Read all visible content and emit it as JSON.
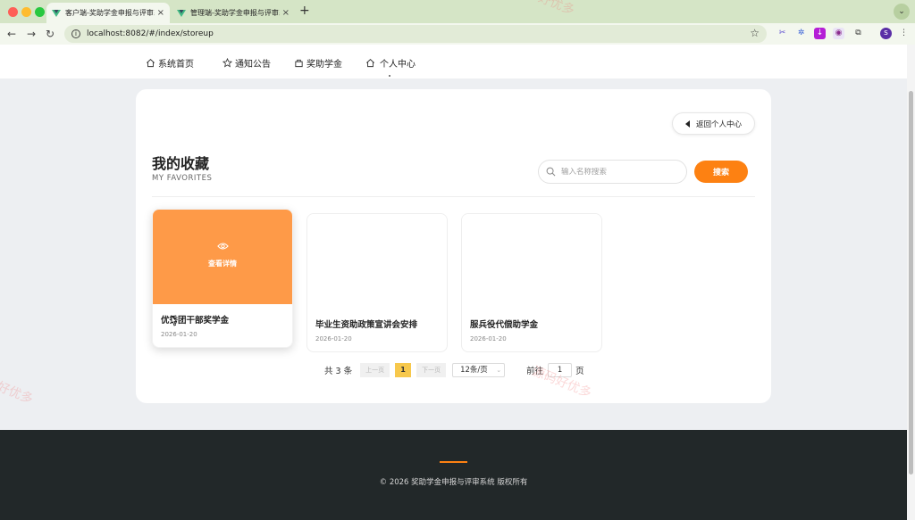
{
  "browser": {
    "tabs": [
      {
        "title": "客户端-奖助学金申报与评审系统",
        "active": true
      },
      {
        "title": "管理端-奖助学金申报与评审系统",
        "active": false
      }
    ],
    "new_tab": "+",
    "url": "localhost:8082/#/index/storeup",
    "profile_initial": "s",
    "expand_icon": "chevron-down-icon"
  },
  "nav": {
    "items": [
      {
        "label": "系统首页",
        "icon": "home-icon"
      },
      {
        "label": "通知公告",
        "icon": "star-icon"
      },
      {
        "label": "奖助学金",
        "icon": "bag-icon"
      },
      {
        "label": "个人中心",
        "icon": "home-icon"
      }
    ]
  },
  "page": {
    "back_label": "返回个人中心",
    "title": "我的收藏",
    "subtitle": "MY FAVORITES",
    "search_placeholder": "输入名称搜索",
    "search_button": "搜索",
    "view_detail": "查看详情"
  },
  "favorites": [
    {
      "name": "优秀团干部奖学金",
      "date": "2026-01-20",
      "hovered": true
    },
    {
      "name": "毕业生资助政策宣讲会安排",
      "date": "2026-01-20",
      "hovered": false
    },
    {
      "name": "服兵役代偿助学金",
      "date": "2026-01-20",
      "hovered": false
    }
  ],
  "pagination": {
    "total": "共 3 条",
    "prev": "上一页",
    "current_page": "1",
    "next": "下一页",
    "page_size": "12条/页",
    "goto_label": "前往",
    "goto_value": "1",
    "page_unit": "页"
  },
  "footer": {
    "copyright": "© 2026 奖助学金申报与评审系统 版权所有"
  },
  "watermark": [
    "源码好优多",
    "好优多"
  ],
  "colors": {
    "accent": "#fd8112",
    "hover_overlay": "#fe9a48",
    "active_page": "#f7c84c",
    "footer_bg": "#222829"
  }
}
